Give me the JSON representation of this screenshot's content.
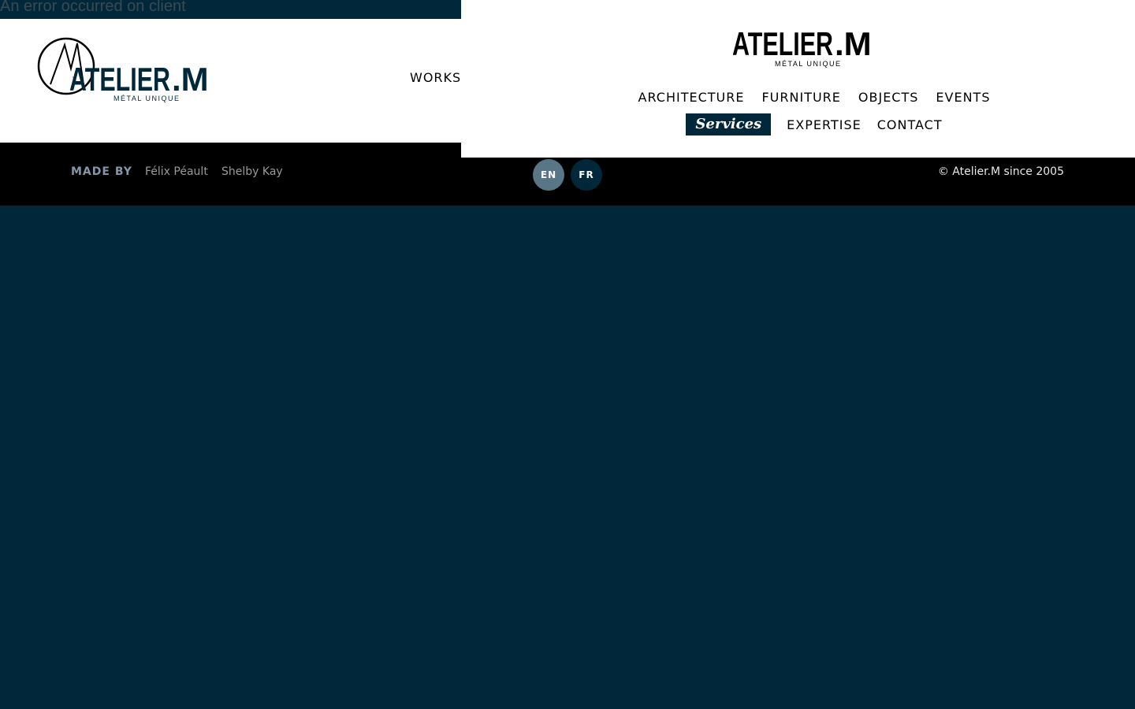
{
  "error": {
    "message": "An error occurred on client"
  },
  "brand": {
    "name": "ATELIER",
    "dot_letter": ".M",
    "tagline": "MÉTAL UNIQUE",
    "color": "#00283a"
  },
  "left_header": {
    "nav_label": "WORKS"
  },
  "menu": {
    "row1": [
      "ARCHITECTURE",
      "FURNITURE",
      "OBJECTS",
      "EVENTS"
    ],
    "active_label": "Services",
    "row2": [
      "EXPERTISE",
      "CONTACT"
    ]
  },
  "footer": {
    "made_by_label": "MADE BY",
    "credits": [
      "Félix Péault",
      "Shelby Kay"
    ],
    "languages": [
      "EN",
      "FR"
    ],
    "active_language": "EN",
    "copyright": "© Atelier.M since 2005"
  },
  "colors": {
    "navy": "#00283a",
    "lang_active": "#587686",
    "footer_bg": "#000000"
  }
}
